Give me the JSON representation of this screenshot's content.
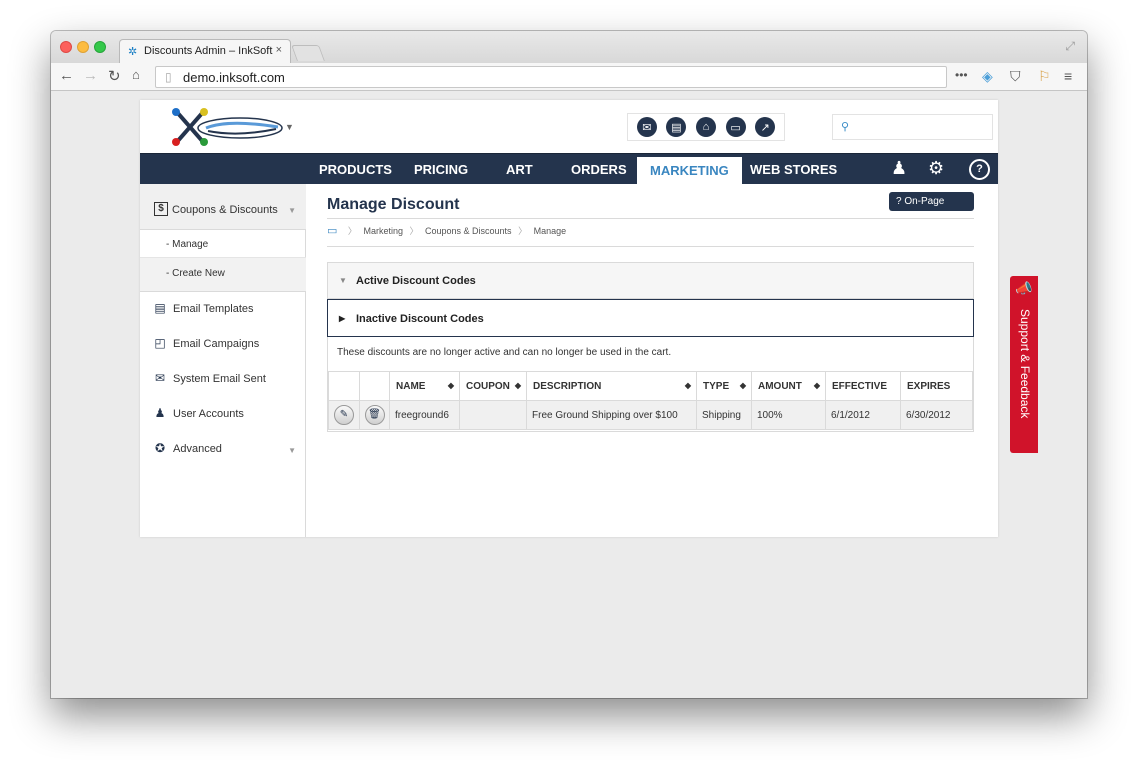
{
  "browser": {
    "tab_title": "Discounts Admin – InkSoft",
    "tab_close": "×",
    "url": "demo.inksoft.com",
    "ext_icons": [
      "more-dots-icon",
      "extension-icon",
      "pocket-icon",
      "bookmark-flag-icon",
      "menu-icon"
    ]
  },
  "nav": {
    "items": [
      {
        "label": "PRODUCTS"
      },
      {
        "label": "PRICING"
      },
      {
        "label": "ART"
      },
      {
        "label": "ORDERS"
      },
      {
        "label": "MARKETING"
      },
      {
        "label": "WEB STORES"
      }
    ],
    "active": "MARKETING",
    "help_label": "?"
  },
  "sidebar": {
    "section_label": "Coupons & Discounts",
    "section_icon_glyph": "$",
    "sub_items": [
      {
        "label": "- Manage"
      },
      {
        "label": "- Create New"
      }
    ],
    "items": [
      {
        "label": "Email Templates",
        "icon": "newspaper-icon"
      },
      {
        "label": "Email Campaigns",
        "icon": "message-icon"
      },
      {
        "label": "System Email Sent",
        "icon": "envelope-icon"
      },
      {
        "label": "User Accounts",
        "icon": "users-icon"
      },
      {
        "label": "Advanced",
        "icon": "advanced-icon"
      }
    ]
  },
  "content": {
    "title": "Manage Discount",
    "help_button": "? On-Page Help",
    "breadcrumb": [
      "Marketing",
      "Coupons & Discounts",
      "Manage"
    ],
    "active_section": "Active Discount Codes",
    "inactive_section": "Inactive Discount Codes",
    "note": "These discounts are no longer active and can no longer be used in the cart.",
    "table": {
      "columns": [
        "NAME",
        "COUPON",
        "DESCRIPTION",
        "TYPE",
        "AMOUNT",
        "EFFECTIVE",
        "EXPIRES"
      ],
      "rows": [
        {
          "name": "freeground6",
          "coupon": "",
          "description": "Free Ground Shipping over $100",
          "type": "Shipping",
          "amount": "100%",
          "effective": "6/1/2012",
          "expires": "6/30/2012"
        }
      ]
    }
  },
  "support_tab": "Support & Feedback",
  "colors": {
    "navy": "#24344d",
    "active_nav_text": "#3a86c0",
    "support_red": "#d0132a"
  }
}
